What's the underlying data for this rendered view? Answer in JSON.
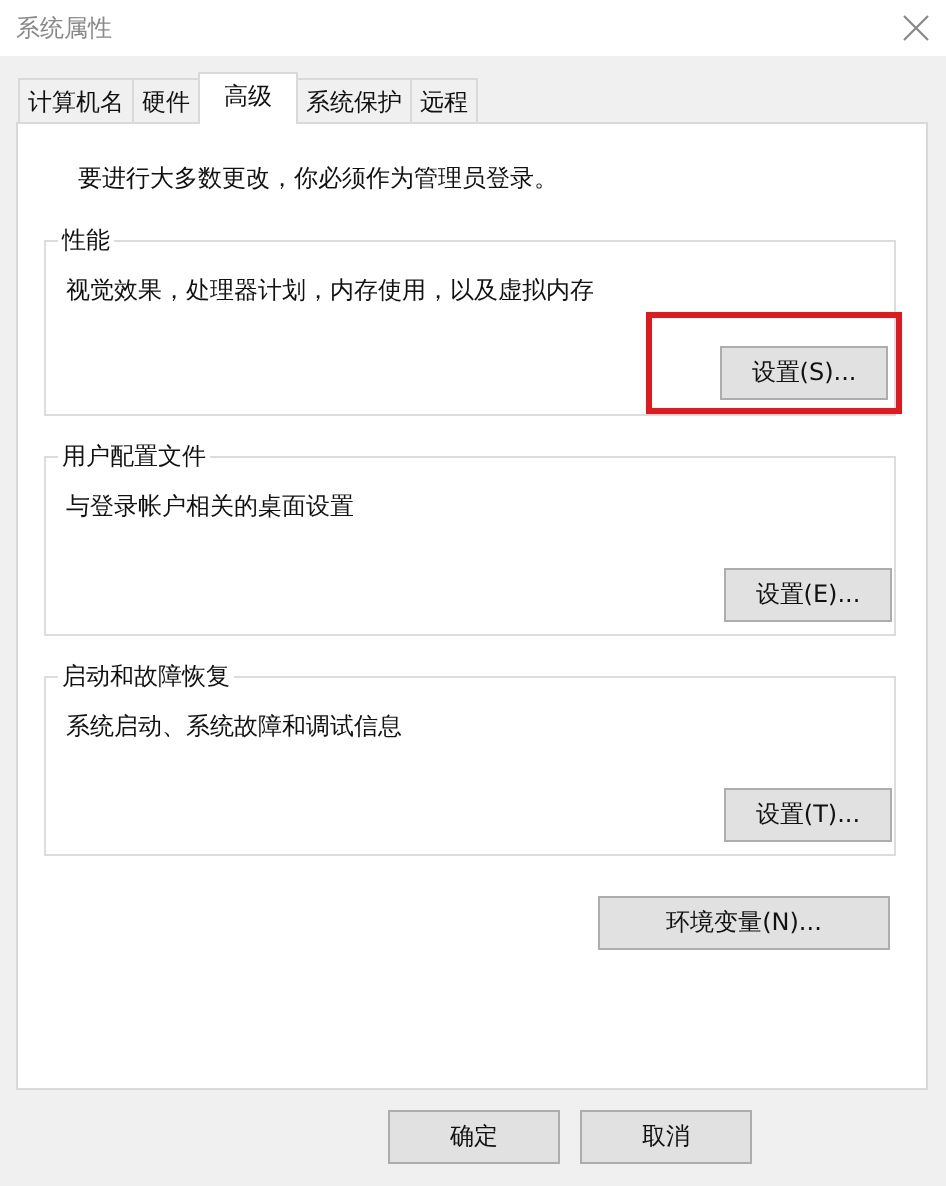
{
  "window": {
    "title": "系统属性"
  },
  "tabs": [
    {
      "label": "计算机名",
      "selected": false
    },
    {
      "label": "硬件",
      "selected": false
    },
    {
      "label": "高级",
      "selected": true
    },
    {
      "label": "系统保护",
      "selected": false
    },
    {
      "label": "远程",
      "selected": false
    }
  ],
  "notice": "要进行大多数更改，你必须作为管理员登录。",
  "groups": [
    {
      "title": "性能",
      "description": "视觉效果，处理器计划，内存使用，以及虚拟内存",
      "button": "设置(S)...",
      "highlighted": true
    },
    {
      "title": "用户配置文件",
      "description": "与登录帐户相关的桌面设置",
      "button": "设置(E)...",
      "highlighted": false
    },
    {
      "title": "启动和故障恢复",
      "description": "系统启动、系统故障和调试信息",
      "button": "设置(T)...",
      "highlighted": false
    }
  ],
  "env_button": "环境变量(N)...",
  "buttons": [
    "确定",
    "取消"
  ]
}
